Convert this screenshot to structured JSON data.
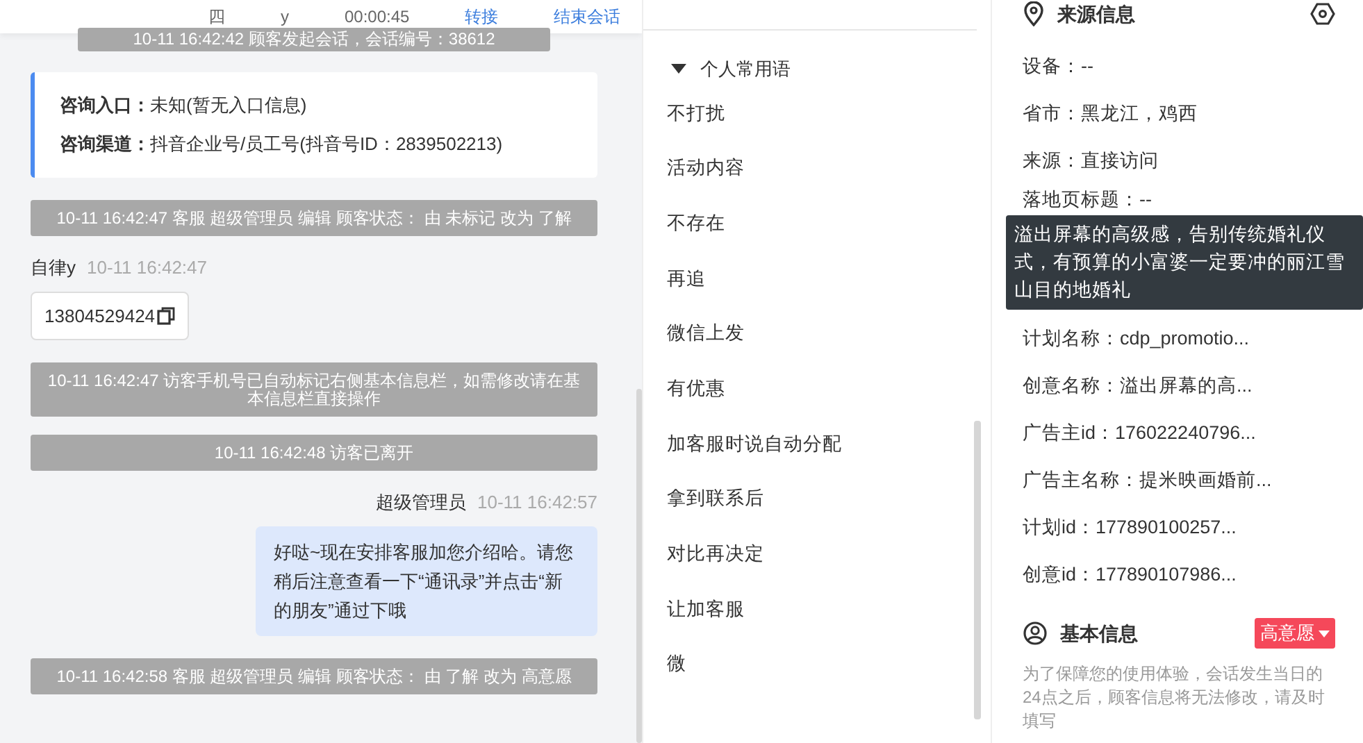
{
  "chat_header": {
    "items": [
      "四",
      "y",
      "00:00:45"
    ],
    "actions": [
      "转接",
      "结束会话"
    ]
  },
  "messages": [
    {
      "kind": "system",
      "text": "10-11 16:42:42 顾客发起会话，会话编号：38612"
    },
    {
      "kind": "info",
      "rows": [
        {
          "label": "咨询入口：",
          "value": "未知(暂无入口信息)"
        },
        {
          "label": "咨询渠道：",
          "value": "抖音企业号/员工号(抖音号ID：2839502213)"
        }
      ]
    },
    {
      "kind": "system",
      "text": "10-11 16:42:47 客服 超级管理员 编辑 顾客状态： 由 未标记 改为 了解"
    },
    {
      "kind": "customer",
      "sender": "自律y",
      "time": "10-11 16:42:47",
      "text": "13804529424"
    },
    {
      "kind": "system",
      "text": "10-11 16:42:47 访客手机号已自动标记右侧基本信息栏，如需修改请在基本信息栏直接操作"
    },
    {
      "kind": "system",
      "text": "10-11 16:42:48 访客已离开"
    },
    {
      "kind": "agent",
      "sender": "超级管理员",
      "time": "10-11 16:42:57",
      "text": "好哒~现在安排客服加您介绍哈。请您稍后注意查看一下“通讯录”并点击“新的朋友”通过下哦"
    },
    {
      "kind": "system",
      "text": "10-11 16:42:58 客服 超级管理员 编辑 顾客状态： 由 了解 改为 高意愿"
    }
  ],
  "phrases": {
    "group": {
      "label": "个人常用语",
      "expanded": true
    },
    "items": [
      "不打扰",
      "活动内容",
      "不存在",
      "再追",
      "微信上发",
      "有优惠",
      "加客服时说自动分配",
      "拿到联系后",
      "对比再决定",
      "让加客服",
      "微"
    ]
  },
  "source_info": {
    "title": "来源信息",
    "items": [
      "设备：--",
      "省市：黑龙江，鸡西",
      "来源：直接访问",
      "落地页标题：--"
    ],
    "tooltip": "溢出屏幕的高级感，告别传统婚礼仪式，有预算的小富婆一定要冲的丽江雪山目的地婚礼",
    "items_after": [
      "计划名称：cdp_promotio...",
      "创意名称：溢出屏幕的高...",
      "广告主id：176022240796...",
      "广告主名称：提米映画婚前...",
      "计划id：177890100257...",
      "创意id：177890107986..."
    ]
  },
  "basic_info": {
    "title": "基本信息",
    "intent": "高意愿",
    "note": "为了保障您的使用体验，会话发生当日的24点之后，顾客信息将无法修改，请及时填写"
  }
}
